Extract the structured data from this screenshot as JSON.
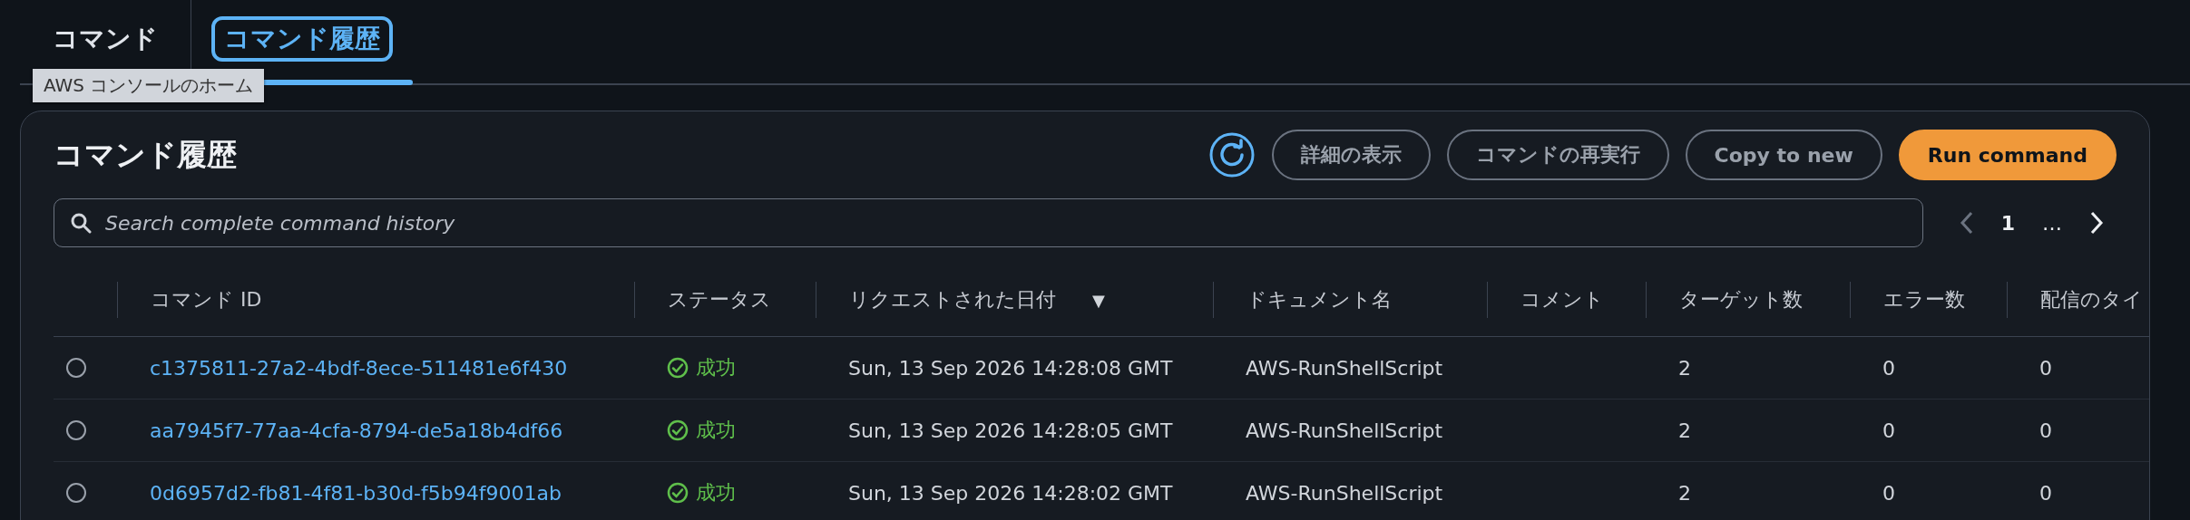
{
  "tabs": [
    {
      "label": "コマンド",
      "selected": false
    },
    {
      "label": "コマンド履歴",
      "selected": true
    }
  ],
  "tooltip": {
    "text": "AWS コンソールのホーム"
  },
  "panel": {
    "title": "コマンド履歴",
    "buttons": [
      {
        "label": "詳細の表示",
        "kind": "normal"
      },
      {
        "label": "コマンドの再実行",
        "kind": "normal"
      },
      {
        "label": "Copy to new",
        "kind": "normal"
      },
      {
        "label": "Run command",
        "kind": "primary"
      }
    ],
    "search": {
      "placeholder": "Search complete command history"
    },
    "pagination": {
      "prev_disabled": true,
      "next_disabled": false,
      "pages": [
        {
          "label": "1",
          "selected": true
        },
        {
          "label": "…",
          "selected": false
        }
      ]
    }
  },
  "table": {
    "columns": [
      {
        "label": "コマンド ID"
      },
      {
        "label": "ステータス"
      },
      {
        "label": "リクエストされた日付",
        "sort_mark": "▼"
      },
      {
        "label": "ドキュメント名"
      },
      {
        "label": "コメント"
      },
      {
        "label": "ターゲット数"
      },
      {
        "label": "エラー数"
      },
      {
        "label": "配信のタイ"
      }
    ],
    "rows": [
      {
        "selected": false,
        "command_id": "c1375811-27a2-4bdf-8ece-511481e6f430",
        "status": {
          "label": "成功",
          "kind": "success"
        },
        "requested": "Sun, 13 Sep 2026 14:28:08 GMT",
        "document": "AWS-RunShellScript",
        "targets": "2",
        "errors": "0",
        "column_8": "0"
      },
      {
        "selected": false,
        "command_id": "aa7945f7-77aa-4cfa-8794-de5a18b4df66",
        "status": {
          "label": "成功",
          "kind": "success"
        },
        "requested": "Sun, 13 Sep 2026 14:28:05 GMT",
        "document": "AWS-RunShellScript",
        "targets": "2",
        "errors": "0",
        "column_8": "0"
      },
      {
        "selected": false,
        "command_id": "0d6957d2-fb81-4f81-b30d-f5b94f9001ab",
        "status": {
          "label": "成功",
          "kind": "success"
        },
        "requested": "Sun, 13 Sep 2026 14:28:02 GMT",
        "document": "AWS-RunShellScript",
        "targets": "2",
        "errors": "0",
        "column_8": "0"
      }
    ]
  }
}
